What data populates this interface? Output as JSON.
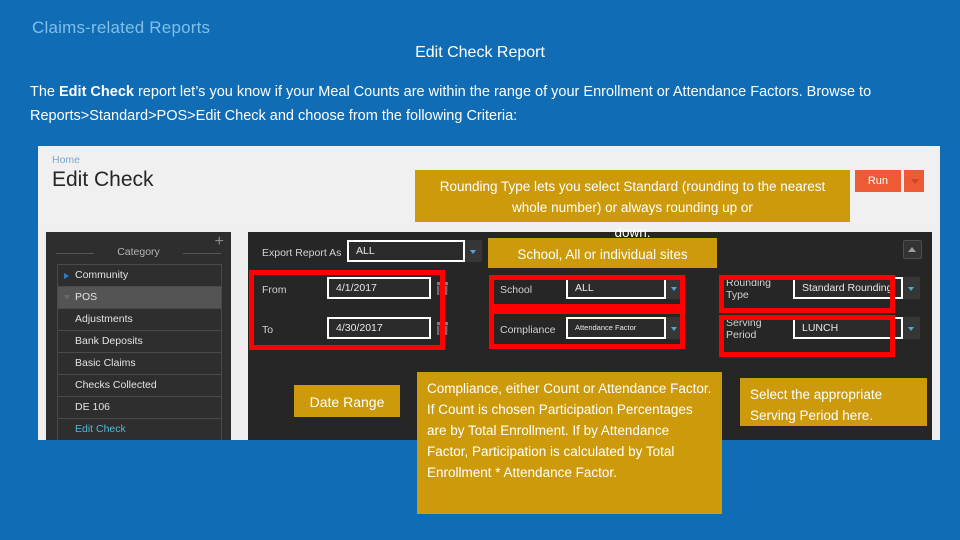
{
  "slide": {
    "kicker": "Claims-related Reports",
    "title": "Edit Check Report",
    "intro_pre": "The ",
    "intro_bold": "Edit Check",
    "intro_post": " report let’s you know if your Meal Counts are within the range of your Enrollment or Attendance Factors. Browse to Reports>Standard>POS>Edit Check and choose from the following Criteria:"
  },
  "app": {
    "breadcrumb": "Home",
    "page_title": "Edit Check",
    "run_label": "Run",
    "run_caret_icon": "chevron-down-icon",
    "collapse_icon": "collapse-up-icon",
    "category": {
      "add_icon": "plus-icon",
      "header": "Category",
      "items": [
        {
          "label": "Community",
          "state": "collapsed",
          "icon": "chevron-right-icon"
        },
        {
          "label": "POS",
          "state": "expanded",
          "icon": "chevron-down-icon"
        },
        {
          "label": "Adjustments",
          "state": "child"
        },
        {
          "label": "Bank Deposits",
          "state": "child"
        },
        {
          "label": "Basic Claims",
          "state": "child"
        },
        {
          "label": "Checks Collected",
          "state": "child"
        },
        {
          "label": "DE 106",
          "state": "child"
        },
        {
          "label": "Edit Check",
          "state": "active"
        }
      ]
    },
    "fields": {
      "export_label": "Export Report As",
      "export_value": "ALL",
      "from_label": "From",
      "from_value": "4/1/2017",
      "to_label": "To",
      "to_value": "4/30/2017",
      "school_label": "School",
      "school_value": "ALL",
      "compliance_label": "Compliance",
      "compliance_value": "Attendance Factor",
      "rounding_label": "Rounding Type",
      "rounding_value": "Standard Rounding",
      "serving_label": "Serving Period",
      "serving_value": "LUNCH",
      "calendar_icon": "calendar-icon",
      "dropdown_icon": "chevron-down-icon"
    }
  },
  "callouts": {
    "rounding": "Rounding Type lets you select Standard (rounding to the nearest whole number) or always rounding up or",
    "rounding_tail": "down.",
    "school": "School, All or individual sites",
    "date_range": "Date Range",
    "compliance": "Compliance, either Count or Attendance Factor. If Count is chosen Participation Percentages are by Total Enrollment. If by Attendance Factor, Participation is calculated by Total Enrollment * Attendance Factor.",
    "serving": "Select the appropriate Serving Period here."
  },
  "colors": {
    "slide_bg": "#0F6CB5",
    "kicker": "#7EC0EA",
    "callout_gold": "#CC9A0B",
    "highlight_red": "#FF0000",
    "run_orange": "#EE5A34"
  }
}
